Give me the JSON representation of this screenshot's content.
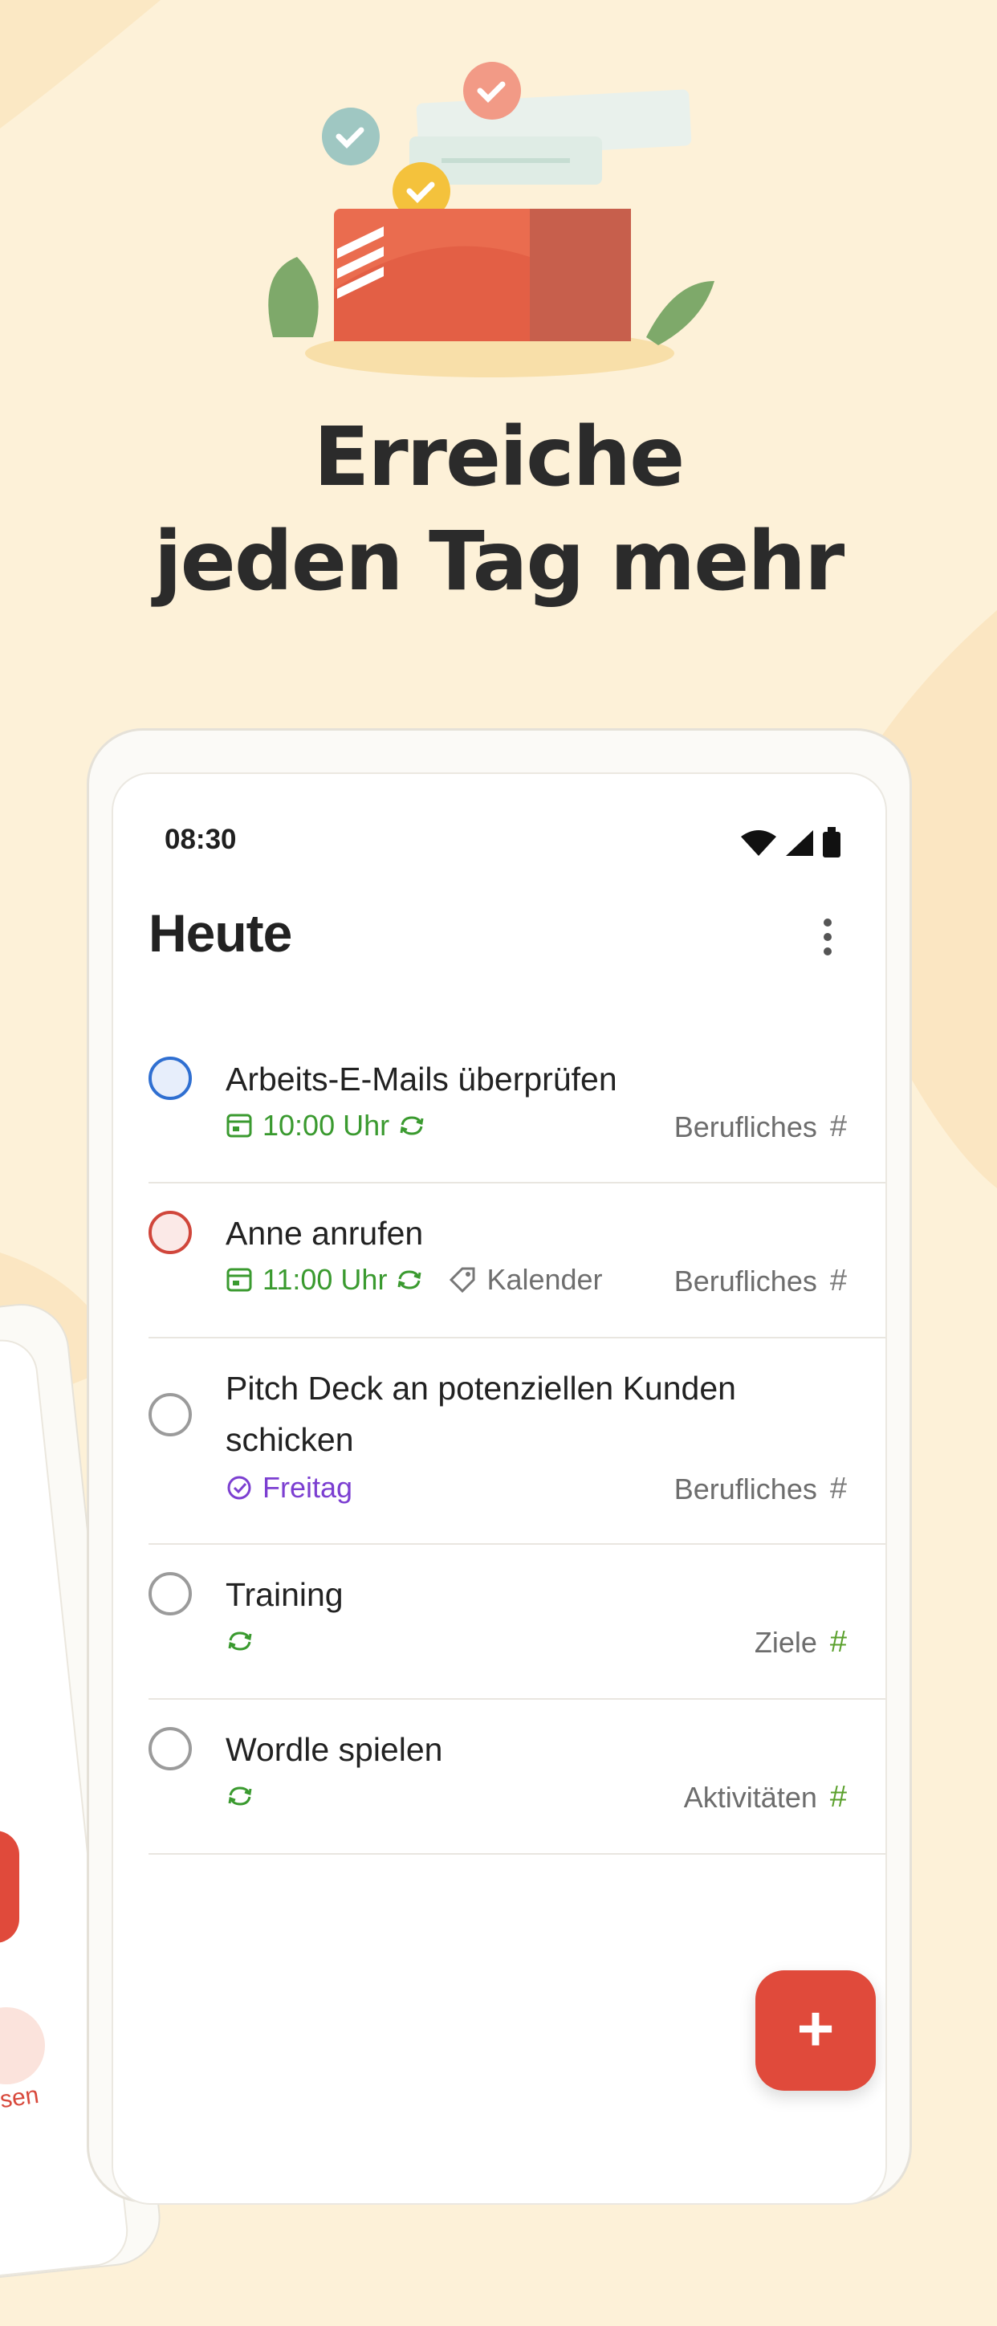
{
  "headline": {
    "line1": "Erreiche",
    "line2": "jeden Tag mehr"
  },
  "status_bar": {
    "time": "08:30"
  },
  "screen": {
    "title": "Heute"
  },
  "tasks": [
    {
      "title": "Arbeits-E-Mails überprüfen",
      "due": "10:00 Uhr",
      "label": "",
      "project": "Berufliches",
      "hash": "#",
      "checkbox_color": "#2f6fd1"
    },
    {
      "title": "Anne anrufen",
      "due": "11:00 Uhr",
      "label": "Kalender",
      "project": "Berufliches",
      "hash": "#",
      "checkbox_color": "#d0463b"
    },
    {
      "title_line1": "Pitch Deck an potenziellen Kunden",
      "title_line2": "schicken",
      "due": "Freitag",
      "project": "Berufliches",
      "hash": "#"
    },
    {
      "title": "Training",
      "project": "Ziele",
      "hash": "#"
    },
    {
      "title": "Wordle spielen",
      "project": "Aktivitäten",
      "hash": "#"
    }
  ],
  "fab": {
    "label": "+"
  },
  "background_phone": {
    "label": "sen"
  },
  "colors": {
    "accent": "#e04a3b",
    "background": "#fdf1d8",
    "green": "#3a9a2f",
    "purple": "#7c3fd1"
  }
}
